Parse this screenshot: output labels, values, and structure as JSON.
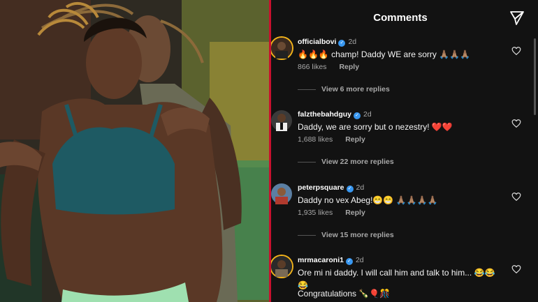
{
  "header": {
    "title": "Comments"
  },
  "icons": {
    "share": "send-icon",
    "like": "heart-icon",
    "verified": "verified-badge-icon"
  },
  "colors": {
    "background": "#121212",
    "verified": "#3897f0",
    "divider": "#c8102e",
    "story_ring": "#f2b31a"
  },
  "comments": [
    {
      "username": "officialbovi",
      "verified": true,
      "time": "2d",
      "text": "🔥🔥🔥 champ! Daddy WE are sorry 🙏🏽🙏🏽🙏🏽",
      "likes": "866 likes",
      "reply": "Reply",
      "view_more": "View 6 more replies"
    },
    {
      "username": "falzthebahdguy",
      "verified": true,
      "time": "2d",
      "text": "Daddy, we are sorry but o nezestry! ❤️❤️",
      "likes": "1,688 likes",
      "reply": "Reply",
      "view_more": "View 22 more replies"
    },
    {
      "username": "peterpsquare",
      "verified": true,
      "time": "2d",
      "text": "Daddy no vex Abeg!😁😁 🙏🏽🙏🏽🙏🏽🙏🏽",
      "likes": "1,935 likes",
      "reply": "Reply",
      "view_more": "View 15 more replies"
    },
    {
      "username": "mrmacaroni1",
      "verified": true,
      "time": "2d",
      "text": "Ore mi ni daddy. I will call him and talk to him... 😂😂😂",
      "text2": "Congratulations 🍾🎈🎊"
    }
  ]
}
